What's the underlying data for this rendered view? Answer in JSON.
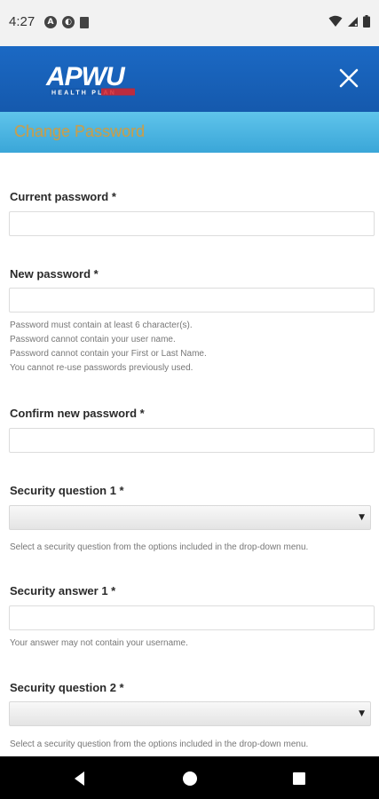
{
  "status_bar": {
    "time": "4:27",
    "left_icons": [
      "a-circle-icon",
      "shield-circle-icon",
      "sd-card-icon"
    ],
    "right_icons": [
      "wifi-icon",
      "signal-icon",
      "battery-icon"
    ]
  },
  "header": {
    "logo_text": "APWU",
    "logo_subtext": "HEALTH PLAN",
    "close_icon": "close-icon",
    "colors": {
      "background": "#1b69c4",
      "title_band": "#4cb6e2",
      "title_text": "#c9a04d"
    }
  },
  "page": {
    "title": "Change Password"
  },
  "form": {
    "current_password": {
      "label": "Current password *",
      "value": ""
    },
    "new_password": {
      "label": "New password *",
      "value": "",
      "help": [
        "Password must contain at least 6 character(s).",
        "Password cannot contain your user name.",
        "Password cannot contain your First or Last Name.",
        "You cannot re-use passwords previously used."
      ]
    },
    "confirm_password": {
      "label": "Confirm new password *",
      "value": ""
    },
    "security_question_1": {
      "label": "Security question 1 *",
      "selected": "",
      "help": "Select a security question from the options included in the drop-down menu."
    },
    "security_answer_1": {
      "label": "Security answer 1 *",
      "value": "",
      "help": "Your answer may not contain your username."
    },
    "security_question_2": {
      "label": "Security question 2 *",
      "selected": "",
      "help": "Select a security question from the options included in the drop-down menu."
    }
  },
  "nav_bar": {
    "buttons": [
      "back-icon",
      "home-icon",
      "recents-icon"
    ]
  }
}
